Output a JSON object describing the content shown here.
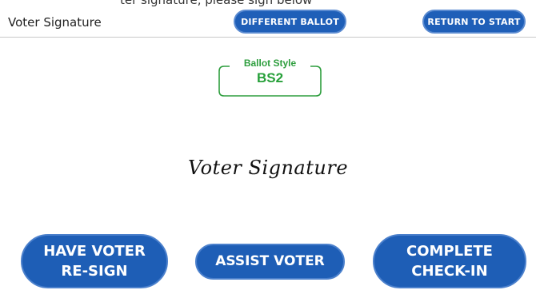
{
  "header": {
    "top_sliver": "ter signature, please sign below",
    "title": "Voter Signature",
    "different_ballot_label": "DIFFERENT BALLOT",
    "return_to_start_label": "RETURN TO START"
  },
  "ballot_style": {
    "label": "Ballot Style",
    "value": "BS2",
    "accent_color": "#2e9e3e"
  },
  "signature": {
    "text": "Voter Signature"
  },
  "actions": {
    "have_voter_resign_line1": "HAVE VOTER",
    "have_voter_resign_line2": "RE-SIGN",
    "assist_voter": "ASSIST VOTER",
    "complete_checkin_line1": "COMPLETE",
    "complete_checkin_line2": "CHECK-IN"
  },
  "colors": {
    "button_blue": "#1f5fb8",
    "divider": "#c8c8c8"
  }
}
